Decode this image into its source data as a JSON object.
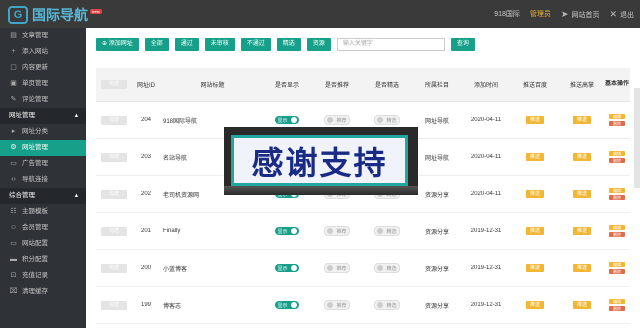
{
  "topbar": {
    "logo_text": "国际导航",
    "logo_badge": "beta",
    "link_home_site": "918国际",
    "admin_name": "管理员",
    "site_home_label": "网站首页",
    "logout_label": "退出"
  },
  "sidebar": {
    "items_top": [
      {
        "label": "文章管理"
      },
      {
        "label": "添入网站"
      },
      {
        "label": "内容更新"
      },
      {
        "label": "单页管理"
      },
      {
        "label": "评论管理"
      }
    ],
    "group1": "网址管理",
    "group1_items": [
      {
        "label": "网址分类"
      },
      {
        "label": "网址管理"
      },
      {
        "label": "广告管理"
      },
      {
        "label": "导航连接"
      }
    ],
    "group2": "综合管理",
    "group2_items": [
      {
        "label": "主题模板"
      },
      {
        "label": "会员管理"
      },
      {
        "label": "网站配置"
      },
      {
        "label": "积分配置"
      },
      {
        "label": "充值记录"
      },
      {
        "label": "清理缓存"
      }
    ]
  },
  "toolbar": {
    "add_label": "添加网址",
    "all_label": "全部",
    "approved_label": "通过",
    "pending_label": "未审核",
    "rejected_label": "不通过",
    "pick_label": "精选",
    "source_label": "资源",
    "search_placeholder": "输入关键字",
    "search_label": "查询"
  },
  "table": {
    "headers": {
      "check": "勾选",
      "id": "网址ID",
      "title": "网站标题",
      "show": "是否显示",
      "recommend": "是否推荐",
      "featured": "是否精选",
      "column": "所属栏目",
      "date": "添加时间",
      "push_baidu": "推送百度",
      "push_bing": "推送高掌",
      "ops": "基本操作"
    },
    "rows": [
      {
        "check": "勾选",
        "id": "204",
        "title": "918国际导航",
        "show": "显示",
        "recommend": "推荐",
        "featured": "精选",
        "column": "网址导航",
        "date": "2020-04-11",
        "push1": "推送",
        "push2": "推送"
      },
      {
        "check": "勾选",
        "id": "203",
        "title": "名站导航",
        "show": "显示",
        "recommend": "推荐",
        "featured": "精选",
        "column": "网址导航",
        "date": "2020-04-11",
        "push1": "推送",
        "push2": "推送"
      },
      {
        "check": "勾选",
        "id": "202",
        "title": "老司机资源网",
        "show": "显示",
        "recommend": "推荐",
        "featured": "精选",
        "column": "资源分享",
        "date": "2020-04-11",
        "push1": "推送",
        "push2": "推送"
      },
      {
        "check": "勾选",
        "id": "201",
        "title": "Finally",
        "show": "显示",
        "recommend": "推荐",
        "featured": "精选",
        "column": "资源分享",
        "date": "2019-12-31",
        "push1": "推送",
        "push2": "推送"
      },
      {
        "check": "勾选",
        "id": "200",
        "title": "小蓝博客",
        "show": "显示",
        "recommend": "推荐",
        "featured": "精选",
        "column": "资源分享",
        "date": "2019-12-31",
        "push1": "推送",
        "push2": "推送"
      },
      {
        "check": "勾选",
        "id": "199",
        "title": "博客志",
        "show": "显示",
        "recommend": "推荐",
        "featured": "精选",
        "column": "资源分享",
        "date": "2019-12-31",
        "push1": "推送",
        "push2": "推送"
      }
    ],
    "op_edit": "编辑",
    "op_delete": "删除"
  },
  "overlay": {
    "text": "感谢支持"
  },
  "colors": {
    "accent": "#16a08a",
    "push": "#f2b632",
    "sidebar_bg": "#2f3237",
    "topbar_bg": "#3a3a3a"
  }
}
